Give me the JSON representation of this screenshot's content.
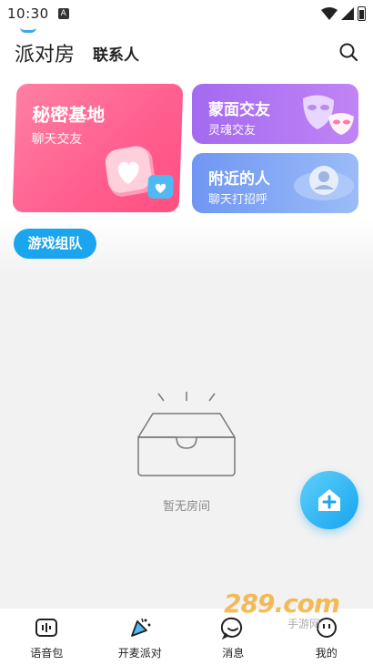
{
  "status_bar": {
    "time": "10:30",
    "notification_letter": "A"
  },
  "header": {
    "tab_party": "派对房",
    "tab_contacts": "联系人"
  },
  "cards": {
    "secret": {
      "title": "秘密基地",
      "subtitle": "聊天交友"
    },
    "mask": {
      "title": "蒙面交友",
      "subtitle": "灵魂交友"
    },
    "nearby": {
      "title": "附近的人",
      "subtitle": "聊天打招呼"
    }
  },
  "game_group_label": "游戏组队",
  "empty_text": "暂无房间",
  "bottom_nav": {
    "items": [
      {
        "label": "语音包",
        "icon": "voice-pack-icon"
      },
      {
        "label": "开麦派对",
        "icon": "party-icon"
      },
      {
        "label": "消息",
        "icon": "message-icon"
      },
      {
        "label": "我的",
        "icon": "profile-icon"
      }
    ]
  },
  "watermark": {
    "text": "289.com",
    "subtext": "手游网"
  },
  "colors": {
    "accent": "#1aa5ee",
    "pink": "#ff5e8e",
    "purple": "#b078f3",
    "blue": "#7fa6f5"
  }
}
